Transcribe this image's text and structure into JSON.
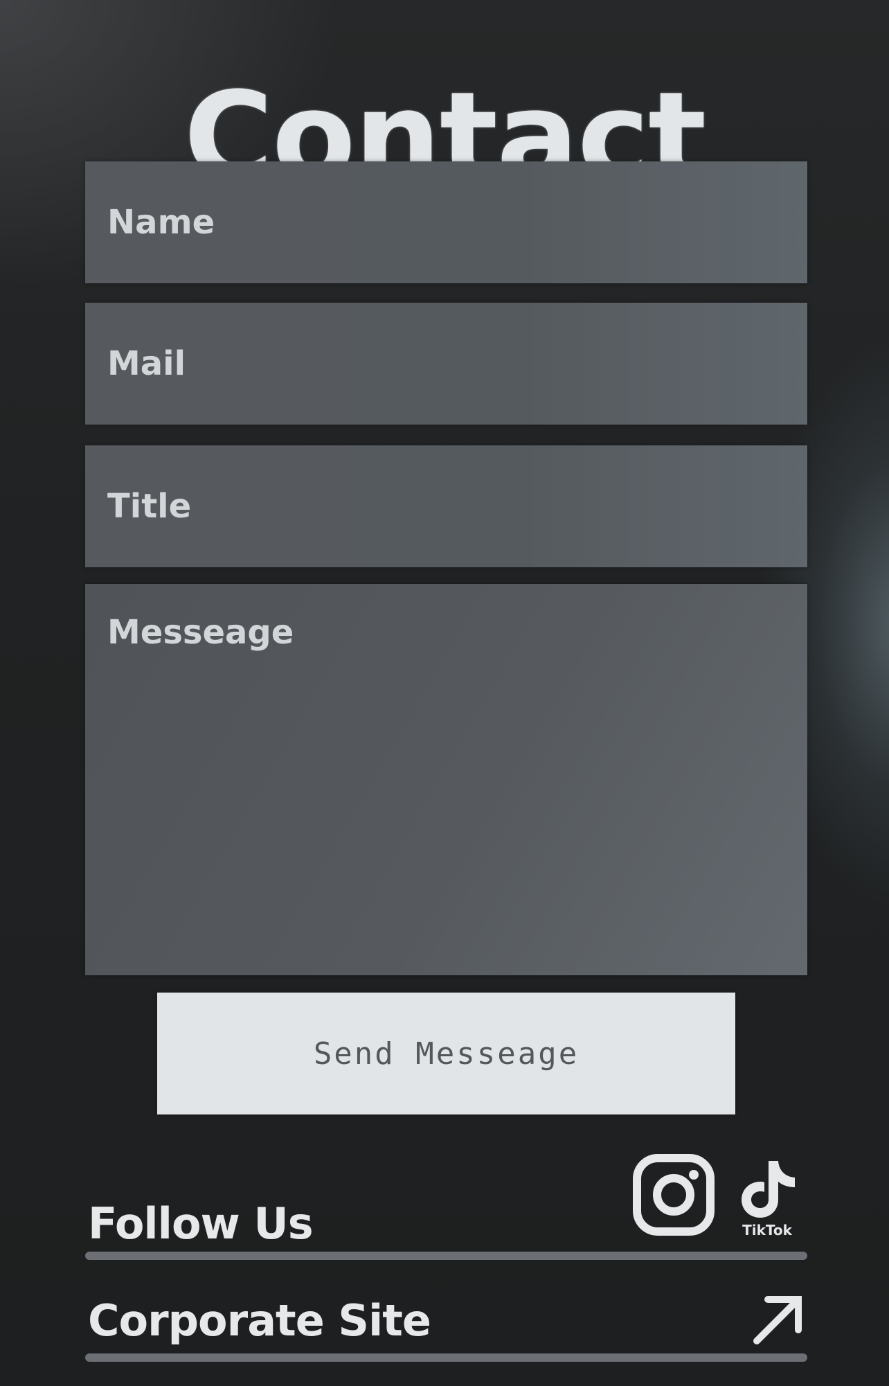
{
  "page": {
    "title": "Contact"
  },
  "form": {
    "name_placeholder": "Name",
    "mail_placeholder": "Mail",
    "title_placeholder": "Title",
    "message_placeholder": "Messeage",
    "submit_label": "Send Messeage"
  },
  "social": {
    "follow_label": "Follow Us",
    "icons": [
      "instagram-icon",
      "tiktok-icon"
    ],
    "tiktok_wordmark": "TikTok"
  },
  "corporate": {
    "label": "Corporate Site",
    "icon": "arrow-up-right-icon"
  },
  "colors": {
    "background": "#202223",
    "field": "#56595d",
    "button": "#e2e5e8",
    "button_text": "#55585b",
    "text": "#e4e7ea",
    "divider": "#6c7075"
  }
}
